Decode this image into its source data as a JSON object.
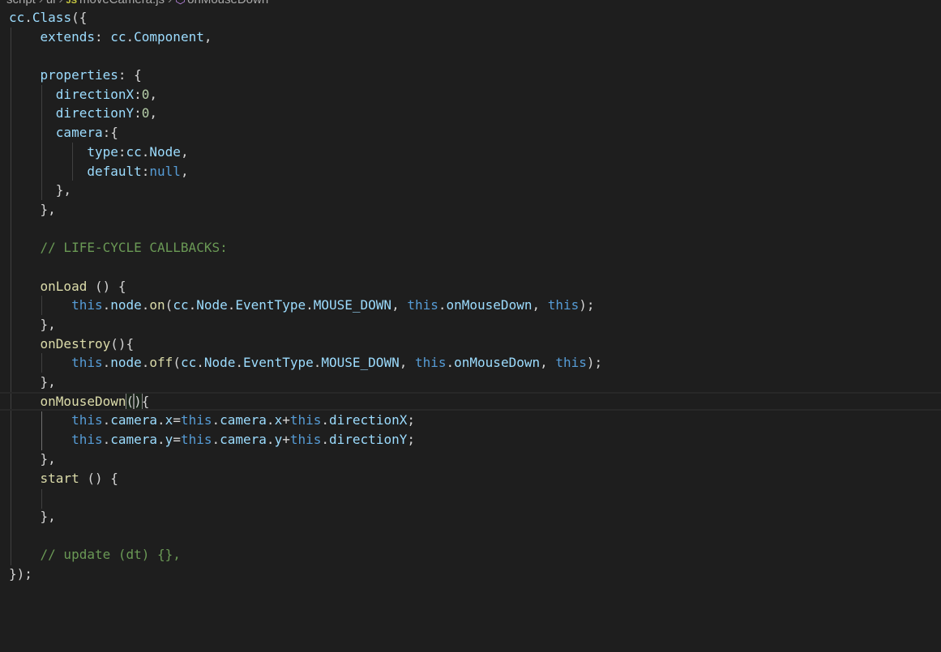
{
  "breadcrumb": {
    "folder1": "script",
    "folder2": "ui",
    "file_icon": "JS",
    "file": "moveCamera.js",
    "symbol": "onMouseDown"
  },
  "code": {
    "l1": {
      "a": "cc",
      "b": ".",
      "c": "Class",
      "d": "({"
    },
    "l2": {
      "a": "extends",
      "b": ": ",
      "c": "cc",
      "d": ".",
      "e": "Component",
      "f": ","
    },
    "l4": {
      "a": "properties",
      "b": ": {"
    },
    "l5": {
      "a": "directionX",
      "b": ":",
      "c": "0",
      "d": ","
    },
    "l6": {
      "a": "directionY",
      "b": ":",
      "c": "0",
      "d": ","
    },
    "l7": {
      "a": "camera",
      "b": ":{"
    },
    "l8": {
      "a": "type",
      "b": ":",
      "c": "cc",
      "d": ".",
      "e": "Node",
      "f": ","
    },
    "l9": {
      "a": "default",
      "b": ":",
      "c": "null",
      "d": ","
    },
    "l10": {
      "a": "},"
    },
    "l11": {
      "a": "},"
    },
    "l13": {
      "a": "// LIFE-CYCLE CALLBACKS:"
    },
    "l15": {
      "a": "onLoad",
      "b": " () {"
    },
    "l16": {
      "a": "this",
      "b": ".",
      "c": "node",
      "d": ".",
      "e": "on",
      "f": "(",
      "g": "cc",
      "h": ".",
      "i": "Node",
      "j": ".",
      "k": "EventType",
      "l": ".",
      "m": "MOUSE_DOWN",
      "n": ", ",
      "o": "this",
      "p": ".",
      "q": "onMouseDown",
      "r": ", ",
      "s": "this",
      "t": ");"
    },
    "l17": {
      "a": "},"
    },
    "l18": {
      "a": "onDestroy",
      "b": "(){"
    },
    "l19": {
      "a": "this",
      "b": ".",
      "c": "node",
      "d": ".",
      "e": "off",
      "f": "(",
      "g": "cc",
      "h": ".",
      "i": "Node",
      "j": ".",
      "k": "EventType",
      "l": ".",
      "m": "MOUSE_DOWN",
      "n": ", ",
      "o": "this",
      "p": ".",
      "q": "onMouseDown",
      "r": ", ",
      "s": "this",
      "t": ");"
    },
    "l20": {
      "a": "},"
    },
    "l21": {
      "a": "onMouseDown",
      "b": "(",
      "c": ")",
      "d": "{"
    },
    "l22": {
      "a": "this",
      "b": ".",
      "c": "camera",
      "d": ".",
      "e": "x",
      "f": "=",
      "g": "this",
      "h": ".",
      "i": "camera",
      "j": ".",
      "k": "x",
      "l": "+",
      "m": "this",
      "n": ".",
      "o": "directionX",
      "p": ";"
    },
    "l23": {
      "a": "this",
      "b": ".",
      "c": "camera",
      "d": ".",
      "e": "y",
      "f": "=",
      "g": "this",
      "h": ".",
      "i": "camera",
      "j": ".",
      "k": "y",
      "l": "+",
      "m": "this",
      "n": ".",
      "o": "directionY",
      "p": ";"
    },
    "l24": {
      "a": "},"
    },
    "l25": {
      "a": "start",
      "b": " () {"
    },
    "l27": {
      "a": "},"
    },
    "l29": {
      "a": "// update (dt) {},"
    },
    "l30": {
      "a": "});"
    }
  },
  "colors": {
    "background": "#1e1e1e",
    "keyword": "#569cd6",
    "property": "#9cdcfe",
    "class": "#4ec9b0",
    "function": "#dcdcaa",
    "number": "#b5cea8",
    "comment": "#6a9955",
    "text": "#d4d4d4"
  }
}
